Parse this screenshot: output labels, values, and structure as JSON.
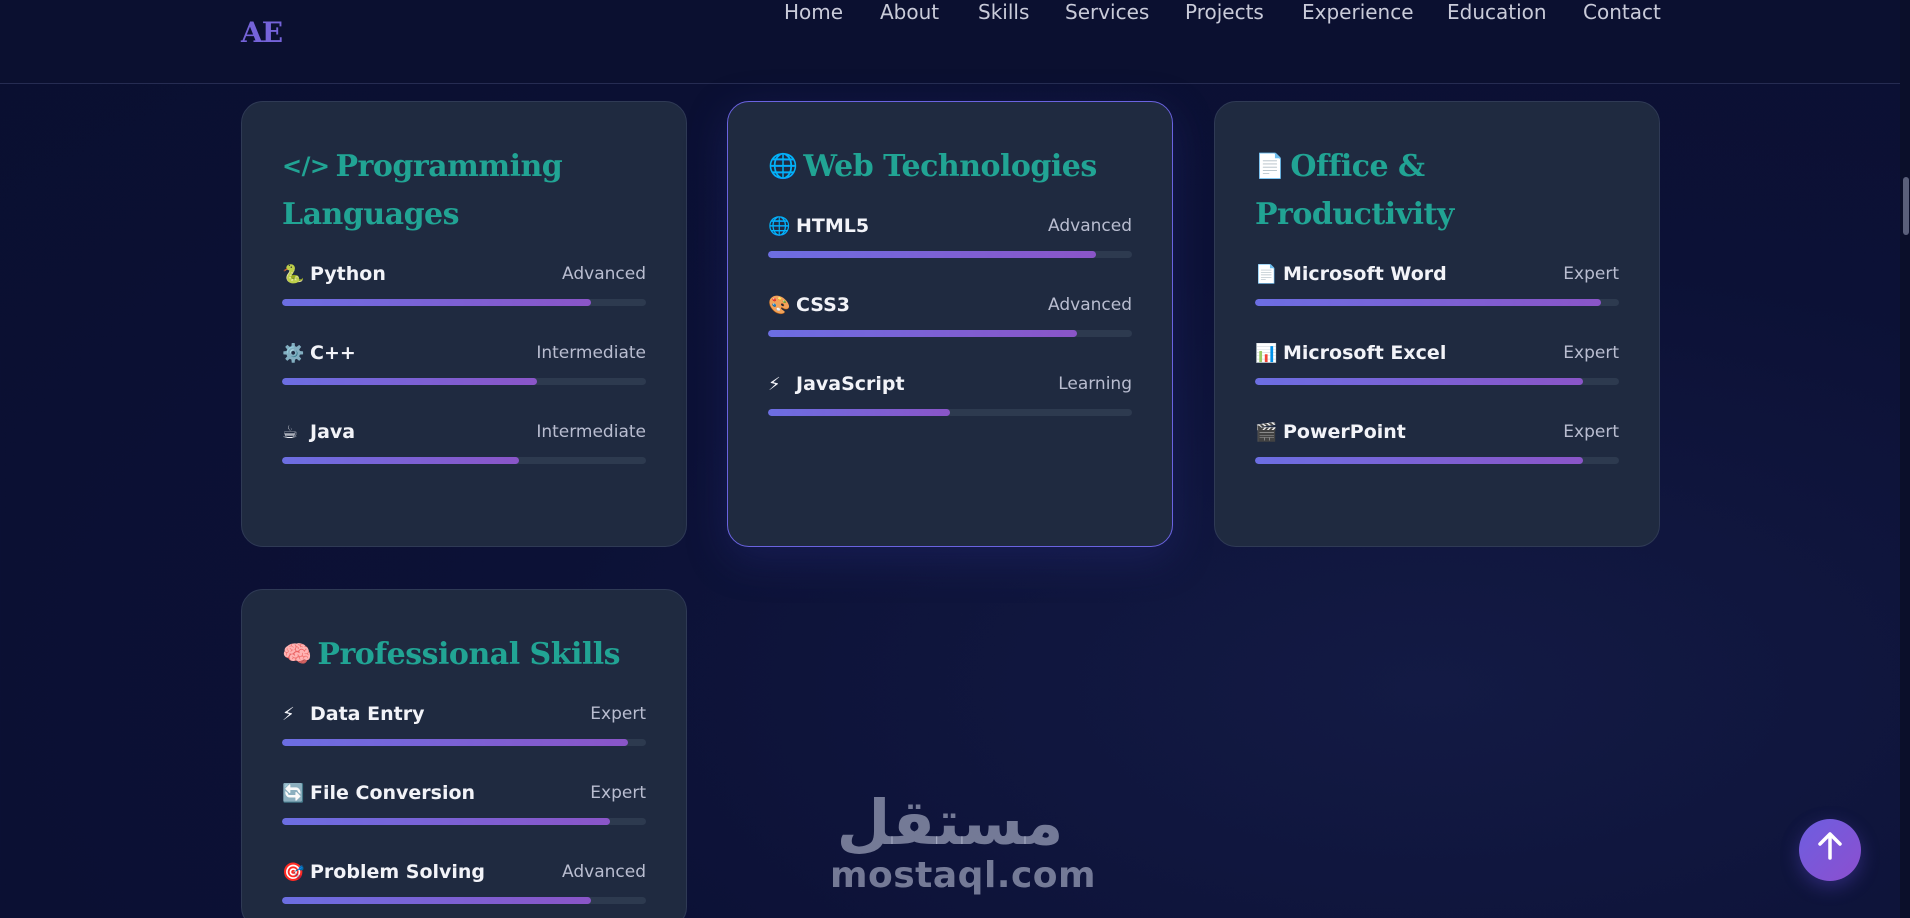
{
  "brand": {
    "logo": "AE"
  },
  "nav": {
    "items": [
      {
        "label": "Home"
      },
      {
        "label": "About"
      },
      {
        "label": "Skills"
      },
      {
        "label": "Services"
      },
      {
        "label": "Projects"
      },
      {
        "label": "Experience"
      },
      {
        "label": "Education"
      },
      {
        "label": "Contact"
      }
    ]
  },
  "cards": [
    {
      "title": "Programming Languages",
      "icon": "code-icon",
      "skills": [
        {
          "name": "Python",
          "icon": "snake-icon",
          "glyph": "🐍",
          "level": "Advanced",
          "percent": 85
        },
        {
          "name": "C++",
          "icon": "gear-icon",
          "glyph": "⚙️",
          "level": "Intermediate",
          "percent": 70
        },
        {
          "name": "Java",
          "icon": "coffee-icon",
          "glyph": "☕",
          "level": "Intermediate",
          "percent": 65
        }
      ]
    },
    {
      "title": "Web Technologies",
      "icon": "globe-icon",
      "skills": [
        {
          "name": "HTML5",
          "icon": "globe-icon",
          "glyph": "🌐",
          "level": "Advanced",
          "percent": 90
        },
        {
          "name": "CSS3",
          "icon": "palette-icon",
          "glyph": "🎨",
          "level": "Advanced",
          "percent": 85
        },
        {
          "name": "JavaScript",
          "icon": "lightning-icon",
          "glyph": "⚡",
          "level": "Learning",
          "percent": 50
        }
      ]
    },
    {
      "title": "Office & Productivity",
      "icon": "document-icon",
      "skills": [
        {
          "name": "Microsoft Word",
          "icon": "page-icon",
          "glyph": "📄",
          "level": "Expert",
          "percent": 95
        },
        {
          "name": "Microsoft Excel",
          "icon": "bar-chart-icon",
          "glyph": "📊",
          "level": "Expert",
          "percent": 90
        },
        {
          "name": "PowerPoint",
          "icon": "film-icon",
          "glyph": "🎬",
          "level": "Expert",
          "percent": 90
        }
      ]
    },
    {
      "title": "Professional Skills",
      "icon": "brain-icon",
      "skills": [
        {
          "name": "Data Entry",
          "icon": "lightning-icon",
          "glyph": "⚡",
          "level": "Expert",
          "percent": 95
        },
        {
          "name": "File Conversion",
          "icon": "refresh-icon",
          "glyph": "🔄",
          "level": "Expert",
          "percent": 90
        },
        {
          "name": "Problem Solving",
          "icon": "target-icon",
          "glyph": "🎯",
          "level": "Advanced",
          "percent": 85
        }
      ]
    }
  ],
  "watermark": {
    "arabic": "مستقل",
    "latin": "mostaql.com"
  },
  "back_to_top": {
    "icon": "arrow-up-icon"
  },
  "colors": {
    "accent_title": "#21a494",
    "logo": "#7563d9",
    "bar_start": "#6c6ee2",
    "bar_end": "#8a55c8",
    "card_bg": "#1f2a40",
    "page_bg": "#0c1136"
  }
}
